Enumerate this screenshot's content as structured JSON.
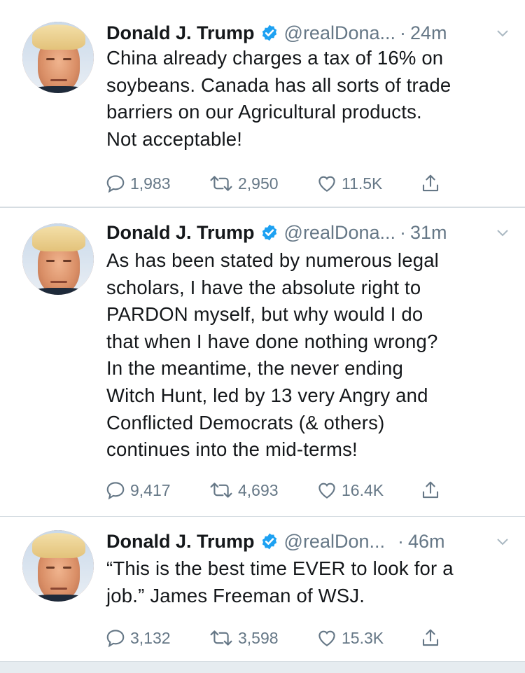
{
  "tweets": [
    {
      "author": "Donald J. Trump",
      "handle": "@realDona...",
      "dot": "·",
      "time": "24m",
      "text": "China already charges a tax of 16% on\nsoybeans. Canada has all sorts of trade\nbarriers on our Agricultural products.\nNot acceptable!",
      "replies": "1,983",
      "retweets": "2,950",
      "likes": "11.5K"
    },
    {
      "author": "Donald J. Trump",
      "handle": "@realDona...",
      "dot": "·",
      "time": "31m",
      "text": "As has been stated by numerous legal\nscholars, I have the absolute right to\nPARDON myself, but why would I do\nthat when I have done nothing wrong?\nIn the meantime, the never ending\nWitch Hunt, led by 13 very Angry and\nConflicted Democrats (& others)\ncontinues into the mid-terms!",
      "replies": "9,417",
      "retweets": "4,693",
      "likes": "16.4K"
    },
    {
      "author": "Donald J. Trump",
      "handle": "@realDon...",
      "dot": "·",
      "time": "46m",
      "text": "“This is the best time EVER to look for a\njob.” James Freeman of WSJ.",
      "replies": "3,132",
      "retweets": "3,598",
      "likes": "15.3K"
    }
  ],
  "colors": {
    "text": "#14171a",
    "secondary": "#657786",
    "verified": "#1da1f2",
    "divider": "#d6dde2",
    "footer": "#e6ecf0"
  },
  "icons": [
    "verified-badge-icon",
    "chevron-down-icon",
    "reply-icon",
    "retweet-icon",
    "like-icon",
    "share-icon"
  ]
}
